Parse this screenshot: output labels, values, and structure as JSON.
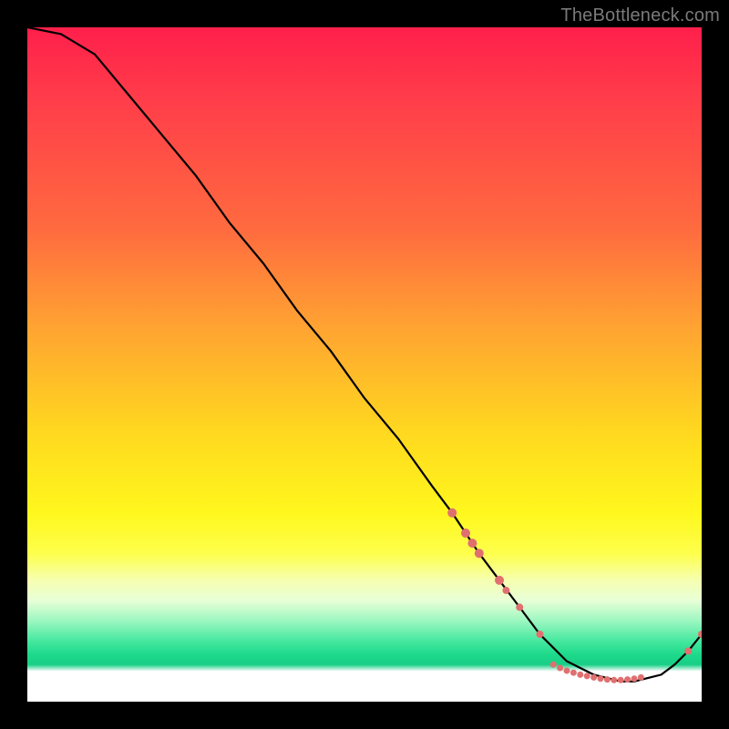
{
  "watermark": "TheBottleneck.com",
  "chart_data": {
    "type": "line",
    "title": "",
    "xlabel": "",
    "ylabel": "",
    "xlim": [
      0,
      100
    ],
    "ylim": [
      0,
      100
    ],
    "series": [
      {
        "name": "curve",
        "x": [
          0,
          5,
          10,
          15,
          20,
          25,
          30,
          35,
          40,
          45,
          50,
          55,
          60,
          63,
          65,
          67,
          70,
          73,
          76,
          78,
          80,
          82,
          84,
          86,
          88,
          90,
          92,
          94,
          96,
          98,
          100
        ],
        "y": [
          100,
          99,
          96,
          90,
          84,
          78,
          71,
          65,
          58,
          52,
          45,
          39,
          32,
          28,
          25,
          22,
          18,
          14,
          10,
          8,
          6,
          5,
          4,
          3.5,
          3,
          3,
          3.5,
          4,
          5.5,
          7.5,
          10
        ]
      }
    ],
    "markers": [
      {
        "x": 63,
        "y": 28,
        "r": 5
      },
      {
        "x": 65,
        "y": 25,
        "r": 5
      },
      {
        "x": 66,
        "y": 23.5,
        "r": 5
      },
      {
        "x": 67,
        "y": 22,
        "r": 5
      },
      {
        "x": 70,
        "y": 18,
        "r": 5
      },
      {
        "x": 71,
        "y": 16.5,
        "r": 4
      },
      {
        "x": 73,
        "y": 14,
        "r": 4
      },
      {
        "x": 76,
        "y": 10,
        "r": 4
      },
      {
        "x": 78,
        "y": 5.5,
        "r": 3.5
      },
      {
        "x": 79,
        "y": 5,
        "r": 3.5
      },
      {
        "x": 80,
        "y": 4.6,
        "r": 3.5
      },
      {
        "x": 81,
        "y": 4.3,
        "r": 3.5
      },
      {
        "x": 82,
        "y": 4,
        "r": 3.5
      },
      {
        "x": 83,
        "y": 3.8,
        "r": 3.5
      },
      {
        "x": 84,
        "y": 3.6,
        "r": 3.5
      },
      {
        "x": 85,
        "y": 3.4,
        "r": 3.5
      },
      {
        "x": 86,
        "y": 3.3,
        "r": 3.5
      },
      {
        "x": 87,
        "y": 3.2,
        "r": 3.5
      },
      {
        "x": 88,
        "y": 3.2,
        "r": 3.5
      },
      {
        "x": 89,
        "y": 3.3,
        "r": 3.5
      },
      {
        "x": 90,
        "y": 3.4,
        "r": 3.5
      },
      {
        "x": 91,
        "y": 3.6,
        "r": 3.5
      },
      {
        "x": 98,
        "y": 7.5,
        "r": 4
      },
      {
        "x": 100,
        "y": 10,
        "r": 4
      }
    ],
    "marker_color": "#e07070",
    "curve_color": "#000000",
    "gradient_stops": [
      {
        "pos": 0,
        "color": "#ff1f4b"
      },
      {
        "pos": 0.45,
        "color": "#ffa531"
      },
      {
        "pos": 0.72,
        "color": "#fff71d"
      },
      {
        "pos": 0.93,
        "color": "#1ed98b"
      },
      {
        "pos": 1.0,
        "color": "#ffffff"
      }
    ]
  }
}
